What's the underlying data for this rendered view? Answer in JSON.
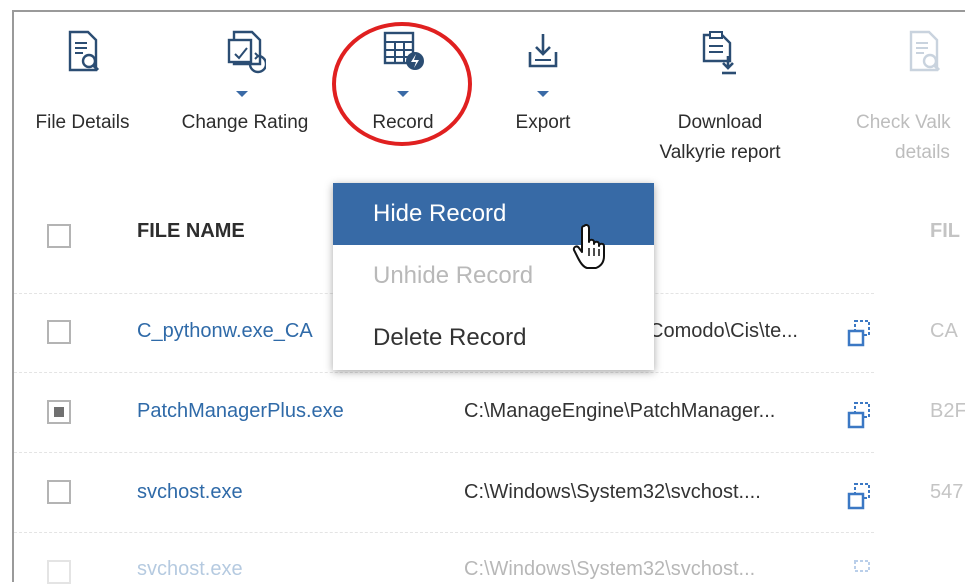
{
  "toolbar": {
    "items": [
      {
        "label": "File Details",
        "icon": "file-search-icon"
      },
      {
        "label": "Change Rating",
        "icon": "file-rating-icon",
        "has_dropdown": true
      },
      {
        "label": "Record",
        "icon": "record-table-icon",
        "has_dropdown": true
      },
      {
        "label": "Export",
        "icon": "export-icon",
        "has_dropdown": true
      },
      {
        "label_line1": "Download",
        "label_line2": "Valkyrie report",
        "icon": "download-report-icon"
      },
      {
        "label_line1": "Check Valk",
        "label_line2": "details",
        "icon": "file-search-icon",
        "disabled": true
      }
    ]
  },
  "table": {
    "headers": {
      "file_name": "FILE NAME",
      "file_hash": "FIL"
    },
    "rows": [
      {
        "name": "C_pythonw.exe_CA",
        "path": "Comodo\\Cis\\te...",
        "hash": "CA",
        "checked": false
      },
      {
        "name": "PatchManagerPlus.exe",
        "path": "C:\\ManageEngine\\PatchManager...",
        "hash": "B2F",
        "checked": true
      },
      {
        "name": "svchost.exe",
        "path": "C:\\Windows\\System32\\svchost....",
        "hash": "547",
        "checked": false
      },
      {
        "name": "svchost.exe",
        "path": "C:\\Windows\\System32\\svchost...",
        "hash": "",
        "checked": false
      }
    ]
  },
  "record_menu": {
    "items": [
      {
        "label": "Hide Record",
        "state": "highlighted"
      },
      {
        "label": "Unhide Record",
        "state": "disabled"
      },
      {
        "label": "Delete Record",
        "state": "normal"
      }
    ]
  },
  "colors": {
    "accent": "#376aa6",
    "highlight_circle": "#e02020",
    "link": "#2f6aa8"
  }
}
